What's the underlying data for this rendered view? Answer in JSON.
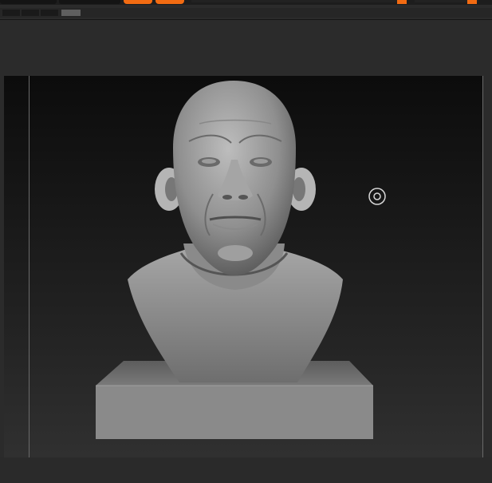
{
  "toolbar": {
    "buttons": [
      "",
      ""
    ],
    "accent_buttons": [
      "",
      ""
    ],
    "accent_color": "#f26b12"
  },
  "subtabs": [
    "",
    "",
    "",
    ""
  ],
  "canvas": {
    "model": "sculpted-head-bust",
    "pedestal": "rectangular-base",
    "pivot_marker": "rotation-pivot-icon"
  }
}
